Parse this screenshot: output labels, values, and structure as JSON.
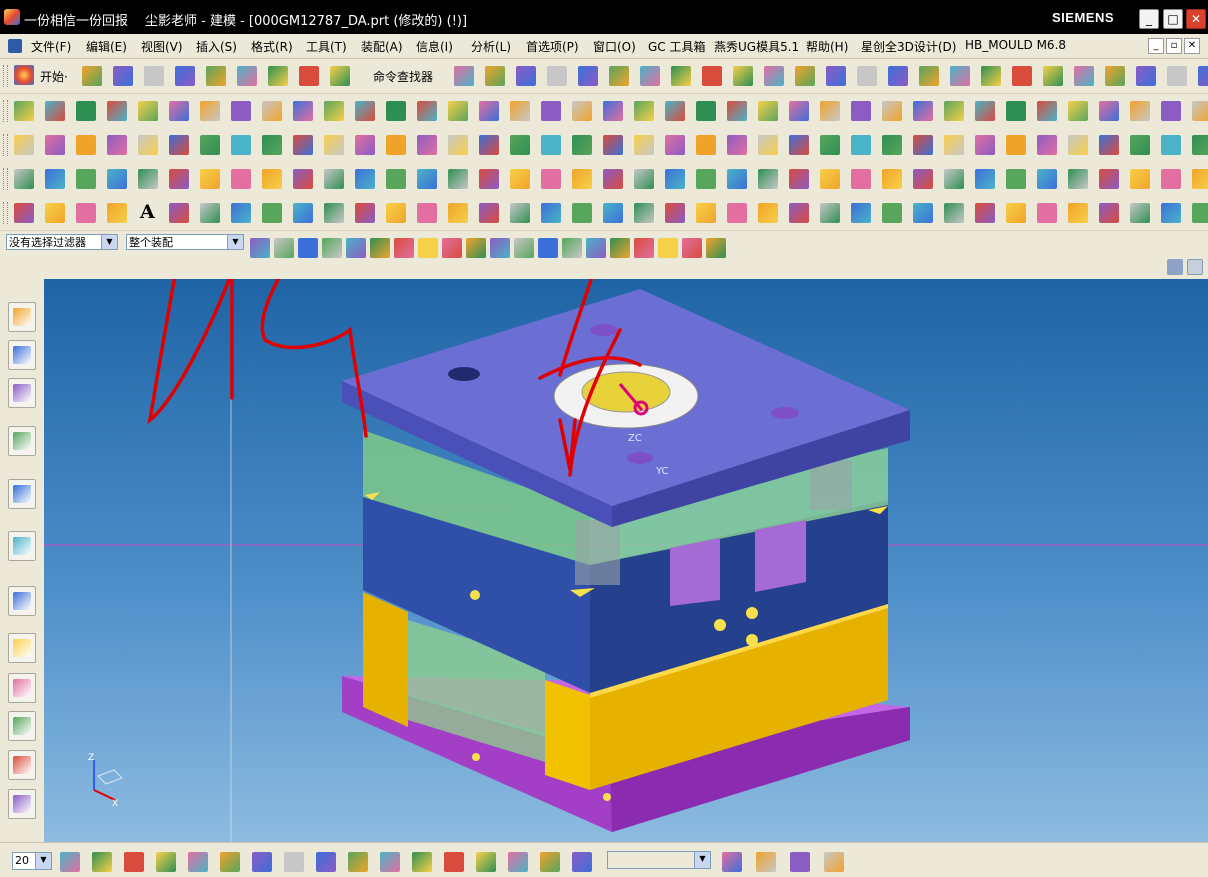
{
  "window": {
    "app_name": "一份相信一份回报",
    "document_title": "尘影老师 - 建模 - [000GM12787_DA.prt  (修改的)    (!)]",
    "brand": "SIEMENS",
    "min_glyph": "_",
    "max_glyph": "□",
    "close_glyph": "✕"
  },
  "menu": {
    "items": [
      "文件(F)",
      "编辑(E)",
      "视图(V)",
      "插入(S)",
      "格式(R)",
      "工具(T)",
      "装配(A)",
      "信息(I)",
      "分析(L)",
      "首选项(P)",
      "窗口(O)",
      "GC 工具箱",
      "燕秀UG模具5.1",
      "帮助(H)",
      "星创全3D设计(D)",
      "HB_MOULD M6.8"
    ]
  },
  "toolbar": {
    "start_label": "开始·",
    "command_finder_label": "命令查找器"
  },
  "selection": {
    "filter_value": "没有选择过滤器",
    "scope_value": "整个装配"
  },
  "statusbar": {
    "zoom_value": "20"
  },
  "viewport": {
    "axis_labels": [
      "ZC",
      "YC"
    ],
    "triad_labels": [
      "Z",
      "X"
    ]
  },
  "colors": {
    "top_clamp_plate": "#6b6fd4",
    "a_plate": "#7fc98a",
    "b_plate": "#2f4fa8",
    "spacer_block": "#e7b100",
    "bottom_clamp_plate": "#a33ec7",
    "annotation": "#e00000",
    "background_top": "#1f64a6"
  },
  "icons": {
    "left_toolbar": [
      "assembly-navigator-icon",
      "constraint-navigator-icon",
      "part-navigator-icon",
      "reuse-library-icon",
      "hd3d-tools-icon",
      "web-browser-icon",
      "history-icon",
      "system-materials-icon",
      "palette-icon",
      "roles-icon",
      "process-studio-icon",
      "manufacturing-wizard-icon"
    ]
  }
}
